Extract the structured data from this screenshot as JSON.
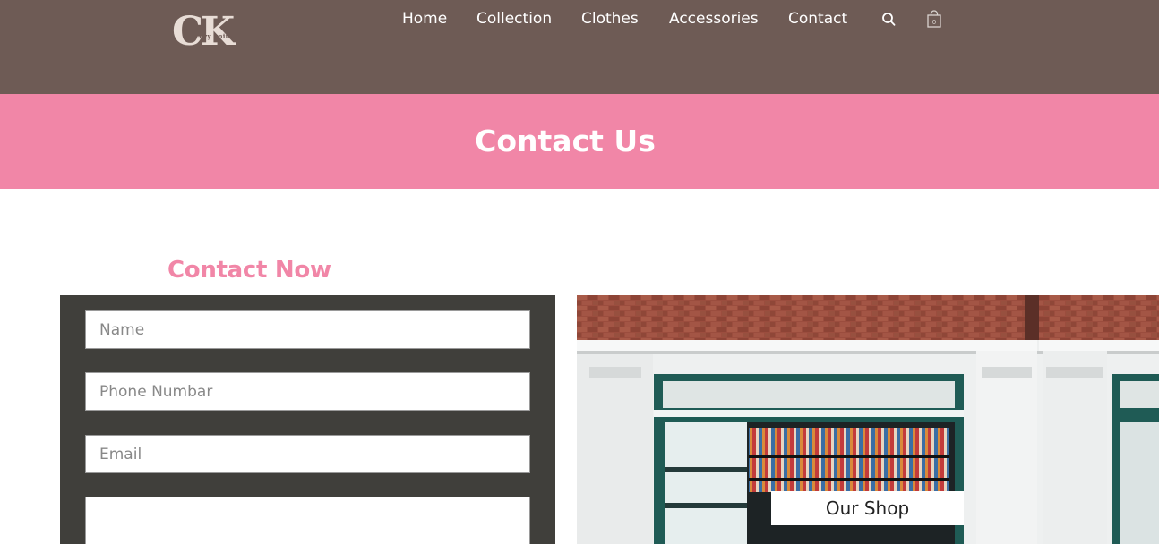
{
  "header": {
    "logo_initials": "CK",
    "logo_tagline": "cozy knits",
    "nav": [
      {
        "label": "Home"
      },
      {
        "label": "Collection"
      },
      {
        "label": "Clothes"
      },
      {
        "label": "Accessories"
      },
      {
        "label": "Contact"
      }
    ],
    "search_icon": "search-icon",
    "cart_icon": "shopping-bag-icon",
    "cart_count": "0"
  },
  "banner": {
    "title": "Contact Us"
  },
  "contact": {
    "heading": "Contact Now",
    "fields": {
      "name_placeholder": "Name",
      "phone_placeholder": "Phone Numbar",
      "email_placeholder": "Email",
      "message_placeholder": ""
    }
  },
  "shop": {
    "caption": "Our Shop"
  },
  "colors": {
    "header_bg": "#6e5b55",
    "accent_pink": "#f186a7",
    "form_bg": "#403f3b"
  }
}
